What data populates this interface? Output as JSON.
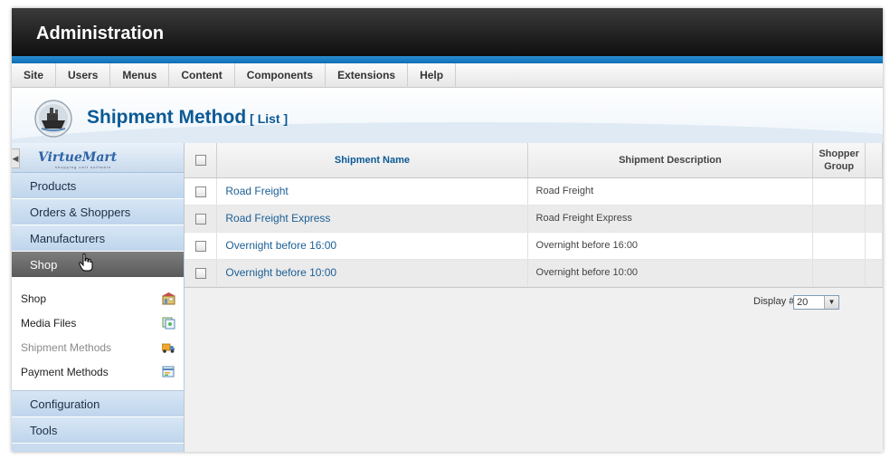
{
  "app": {
    "title": "Administration"
  },
  "menu": [
    {
      "label": "Site"
    },
    {
      "label": "Users"
    },
    {
      "label": "Menus"
    },
    {
      "label": "Content"
    },
    {
      "label": "Components"
    },
    {
      "label": "Extensions"
    },
    {
      "label": "Help"
    }
  ],
  "page": {
    "title": "Shipment Method",
    "subtitle": "[ List ]",
    "icon": "ship-icon"
  },
  "sidebar": {
    "logo": "VirtueMart",
    "logo_tagline": "shopping cart software",
    "items_top": [
      {
        "label": "Products"
      },
      {
        "label": "Orders & Shoppers"
      },
      {
        "label": "Manufacturers"
      },
      {
        "label": "Shop",
        "active": true
      }
    ],
    "submenu": [
      {
        "label": "Shop",
        "icon": "shop-icon"
      },
      {
        "label": "Media Files",
        "icon": "media-icon"
      },
      {
        "label": "Shipment Methods",
        "icon": "truck-icon",
        "current": true
      },
      {
        "label": "Payment Methods",
        "icon": "payment-icon"
      }
    ],
    "items_bottom": [
      {
        "label": "Configuration"
      },
      {
        "label": "Tools"
      }
    ]
  },
  "table": {
    "headers": {
      "name": "Shipment Name",
      "description": "Shipment Description",
      "group": "Shopper Group"
    },
    "rows": [
      {
        "name": "Road Freight",
        "description": "Road Freight"
      },
      {
        "name": "Road Freight Express",
        "description": "Road Freight Express"
      },
      {
        "name": "Overnight before 16:00",
        "description": "Overnight before 16:00"
      },
      {
        "name": "Overnight before 10:00",
        "description": "Overnight before 10:00"
      }
    ]
  },
  "pager": {
    "label": "Display #",
    "value": "20"
  }
}
